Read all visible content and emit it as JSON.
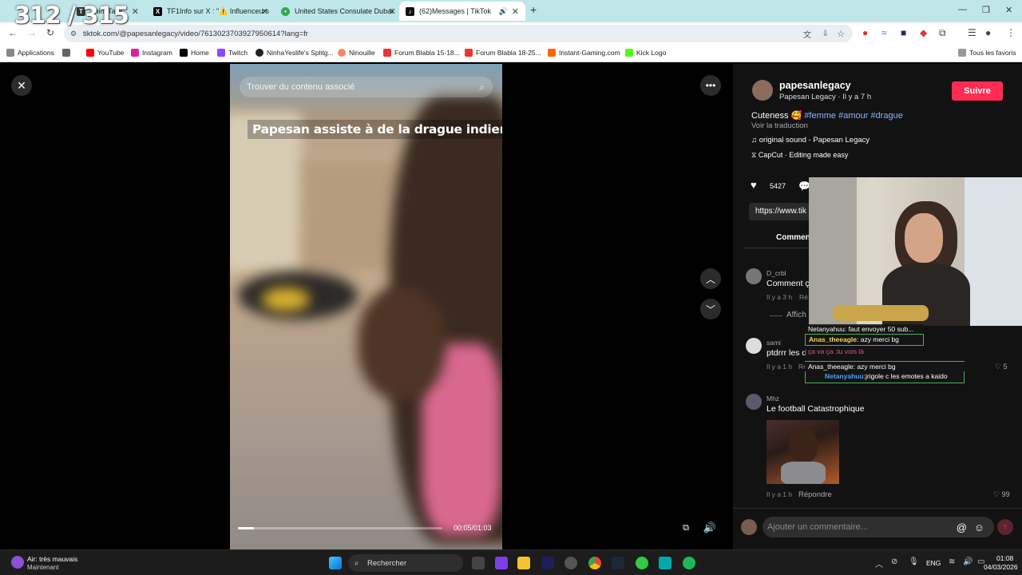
{
  "overlay_counter": "312 / 315",
  "tabs": [
    {
      "label": "ThinkTank",
      "icon": "thinktank-icon"
    },
    {
      "label": "TF1Info sur X : \"⚠️ Influenceurs",
      "icon": "x-logo-icon"
    },
    {
      "label": "United States Consulate Dubai",
      "icon": "maps-pin-icon"
    },
    {
      "label": "(62)Messages | TikTok",
      "icon": "tiktok-icon"
    }
  ],
  "address_bar": {
    "url": "tiktok.com/@papesanlegacy/video/7613023703927950614?lang=fr"
  },
  "bookmarks": {
    "items": [
      "Applications",
      "YouTube",
      "Instagram",
      "Home",
      "Twitch",
      "NinhaYeslife's Splitg...",
      "Ninouille",
      "Forum Blabla 15-18...",
      "Forum Blabla 18-25...",
      "Instant-Gaming.com",
      "Kick Logo"
    ],
    "all_label": "Tous les favoris"
  },
  "video": {
    "search_placeholder": "Trouver du contenu associé",
    "caption": "Papesan assiste à de la drague indienne 🤣",
    "time": "00:05/01:03",
    "progress": 0.08
  },
  "post": {
    "username": "papesanlegacy",
    "display_meta": "Papesan Legacy · Il y a 7 h",
    "follow_label": "Suivre",
    "description_text": "Cuteness 🥰",
    "hashtags": "#femme #amour #drague",
    "translate_label": "Voir la traduction",
    "sound": "original sound - Papesan Legacy",
    "capcut": "CapCut · Editing made easy",
    "likes": "5427",
    "link": "https://www.tik",
    "comments_tab": "Commen"
  },
  "comments": [
    {
      "user": "D_crbl",
      "text": "Comment ç",
      "time": "Il y a 3 h",
      "reply": "Ré",
      "more": "Affich"
    },
    {
      "user": "sami",
      "text": "ptdrrr les d",
      "time": "Il y a 1 h",
      "reply": "Ré",
      "likes": "5"
    },
    {
      "user": "Mhz",
      "text": "Le football Catastrophique",
      "time": "Il y a 1 h",
      "reply": "Répondre",
      "likes": "99"
    }
  ],
  "stream_chat": [
    {
      "text": "Netanyahuu: faut envoyer 50 sub..."
    },
    {
      "user": "Anas_theeagle",
      "text": ": azy merci bg"
    },
    {
      "text": "ça va ça :tu vois là"
    },
    {
      "text": "Anas_theeagle: azy merci bg"
    },
    {
      "user": "Netanyahuu",
      "text": ":jrigole c les emotes a kaido"
    }
  ],
  "comment_input_placeholder": "Ajouter un commentaire...",
  "taskbar": {
    "weather_title": "Air: très mauvais",
    "weather_sub": "Maintenant",
    "search_label": "Rechercher",
    "lang": "ENG",
    "time": "01:08",
    "date": "04/03/2026"
  },
  "colors": {
    "accent": "#fe2c55",
    "hashtag": "#8ab4ff",
    "tabstrip": "#bfe7e9"
  }
}
